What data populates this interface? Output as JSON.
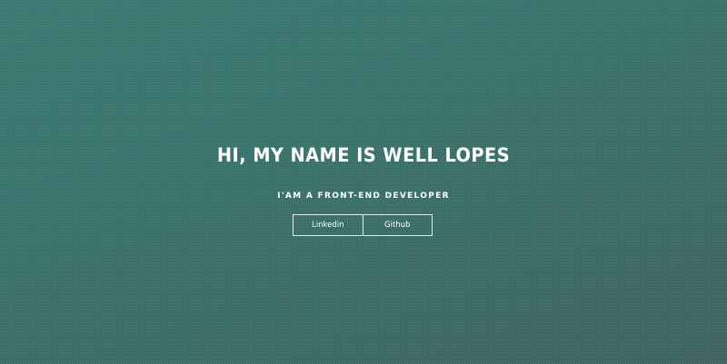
{
  "hero": {
    "headline": "HI, MY NAME IS WELL LOPES",
    "subtitle": "I'AM A FRONT-END DEVELOPER",
    "buttons": [
      {
        "label": "Linkedin"
      },
      {
        "label": "Github"
      }
    ]
  },
  "colors": {
    "background_start": "#3b7a72",
    "background_end": "#3f6461",
    "text": "#ffffff"
  }
}
